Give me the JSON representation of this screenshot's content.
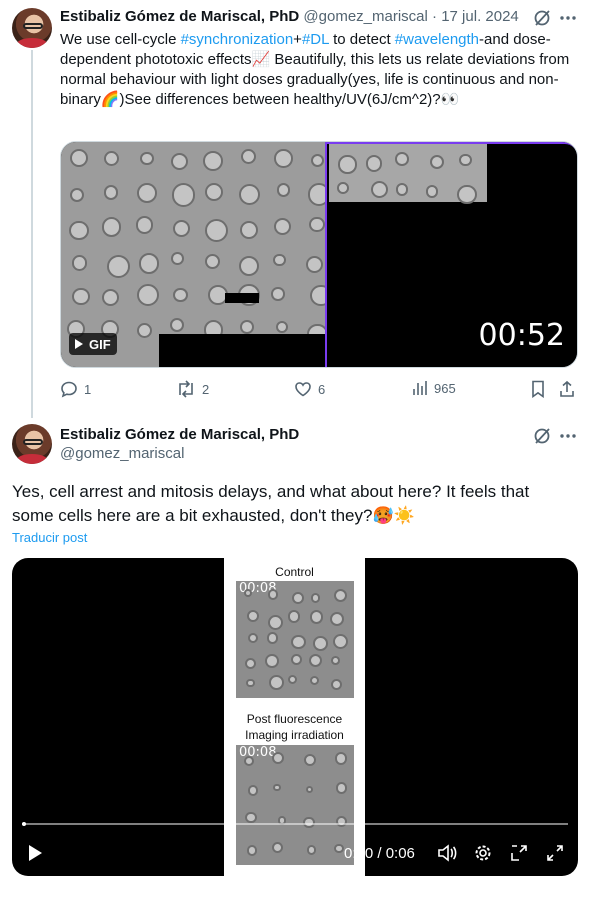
{
  "tweet1": {
    "author_name": "Estibaliz Gómez de Mariscal, PhD",
    "handle": "@gomez_mariscal",
    "separator": "·",
    "date": "17 jul. 2024",
    "text_parts": [
      {
        "t": "We use cell-cycle ",
        "tag": false
      },
      {
        "t": "#synchronization",
        "tag": true
      },
      {
        "t": "+",
        "tag": false
      },
      {
        "t": "#DL",
        "tag": true
      },
      {
        "t": " to detect ",
        "tag": false
      },
      {
        "t": "#wavelength",
        "tag": true
      },
      {
        "t": "-and dose-dependent phototoxic effects📈 Beautifully, this lets us relate deviations from normal behaviour with light doses gradually(yes, life is continuous and non-binary🌈)See differences between healthy/UV(6J/cm^2)?👀",
        "tag": false
      }
    ],
    "media": {
      "badge": "GIF",
      "timer": "00:52"
    },
    "actions": {
      "replies": "1",
      "reposts": "2",
      "likes": "6",
      "views": "965"
    }
  },
  "tweet2": {
    "author_name": "Estibaliz Gómez de Mariscal, PhD",
    "handle": "@gomez_mariscal",
    "text": "Yes, cell arrest and mitosis delays, and what about here? It feels that some cells here are a bit exhausted, don't they?🥵☀️",
    "translate": "Traducir post",
    "video": {
      "label_control": "Control",
      "label_post_1": "Post fluorescence",
      "label_post_2": "Imaging irradiation",
      "timestamp_top": "00:08",
      "timestamp_bottom": "00:08",
      "time": "0:00 / 0:06"
    }
  },
  "colors": {
    "accent": "#1d9bf0",
    "muted": "#536471",
    "gif_border": "#7a3cf0"
  }
}
